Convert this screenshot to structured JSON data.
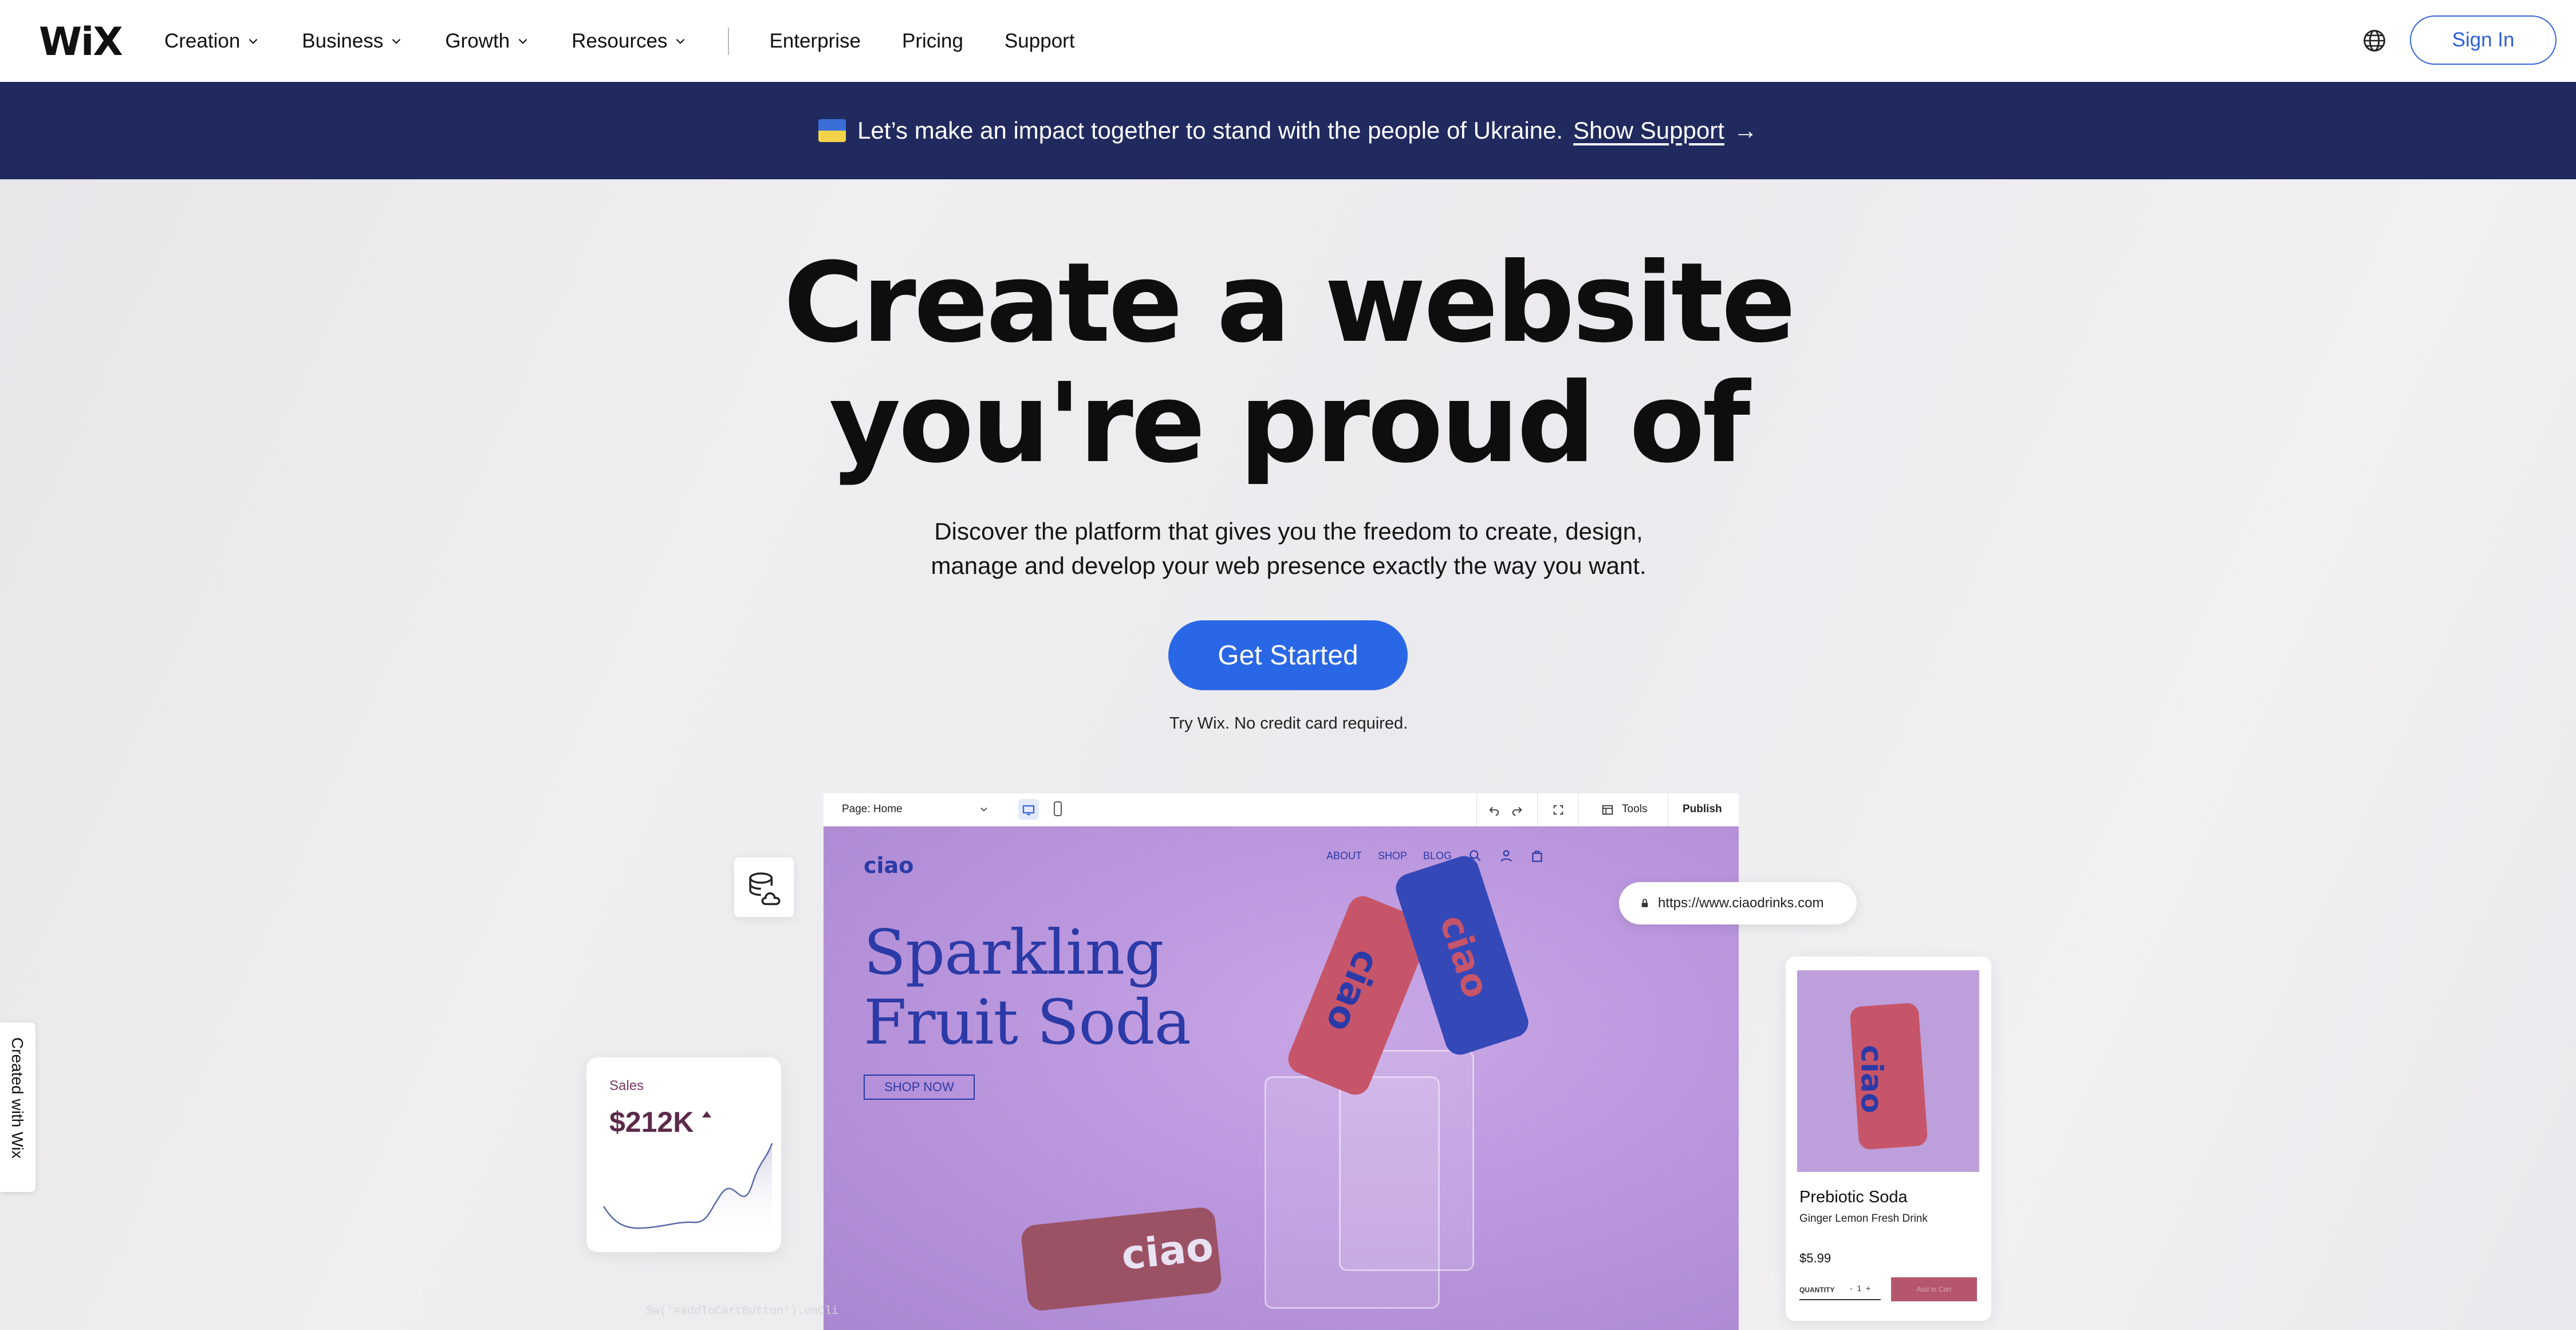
{
  "header": {
    "logo": "WiX",
    "nav": [
      {
        "label": "Creation",
        "dropdown": true
      },
      {
        "label": "Business",
        "dropdown": true
      },
      {
        "label": "Growth",
        "dropdown": true
      },
      {
        "label": "Resources",
        "dropdown": true
      }
    ],
    "links": [
      "Enterprise",
      "Pricing",
      "Support"
    ],
    "language_icon": "globe-icon",
    "sign_in": "Sign In"
  },
  "banner": {
    "text": "Let’s make an impact together to stand with the people of Ukraine.",
    "link": "Show Support",
    "arrow": "→",
    "colors": {
      "background": "#212a5e",
      "flag_top": "#3a6fd8",
      "flag_bottom": "#f3d34a"
    }
  },
  "hero": {
    "title_line1": "Create a website",
    "title_line2": "you're proud of",
    "subtitle_line1": "Discover the platform that gives you the freedom to create, design,",
    "subtitle_line2": "manage and develop your web presence exactly the way you want.",
    "cta": "Get Started",
    "cta_note": "Try Wix. No credit card required.",
    "accent": "#2a67e6"
  },
  "editor": {
    "page_select": "Page: Home",
    "tools": "Tools",
    "publish": "Publish",
    "site": {
      "logo": "ciao",
      "nav": [
        "ABOUT",
        "SHOP",
        "BLOG"
      ],
      "title_line1": "Sparkling",
      "title_line2": "Fruit Soda",
      "shop_button": "SHOP NOW",
      "can_label": "ciao"
    }
  },
  "widgets": {
    "url": "https://www.ciaodrinks.com",
    "sales_label": "Sales",
    "sales_value": "$212K",
    "product": {
      "name": "Prebiotic Soda",
      "description": "Ginger Lemon Fresh Drink",
      "price": "$5.99",
      "quantity_label": "QUANTITY",
      "quantity_value": "1",
      "add_to_cart": "Add to Cart"
    },
    "created_with": "Created with Wix",
    "ghost_code": "$w('#addToCartButton').onCli"
  }
}
